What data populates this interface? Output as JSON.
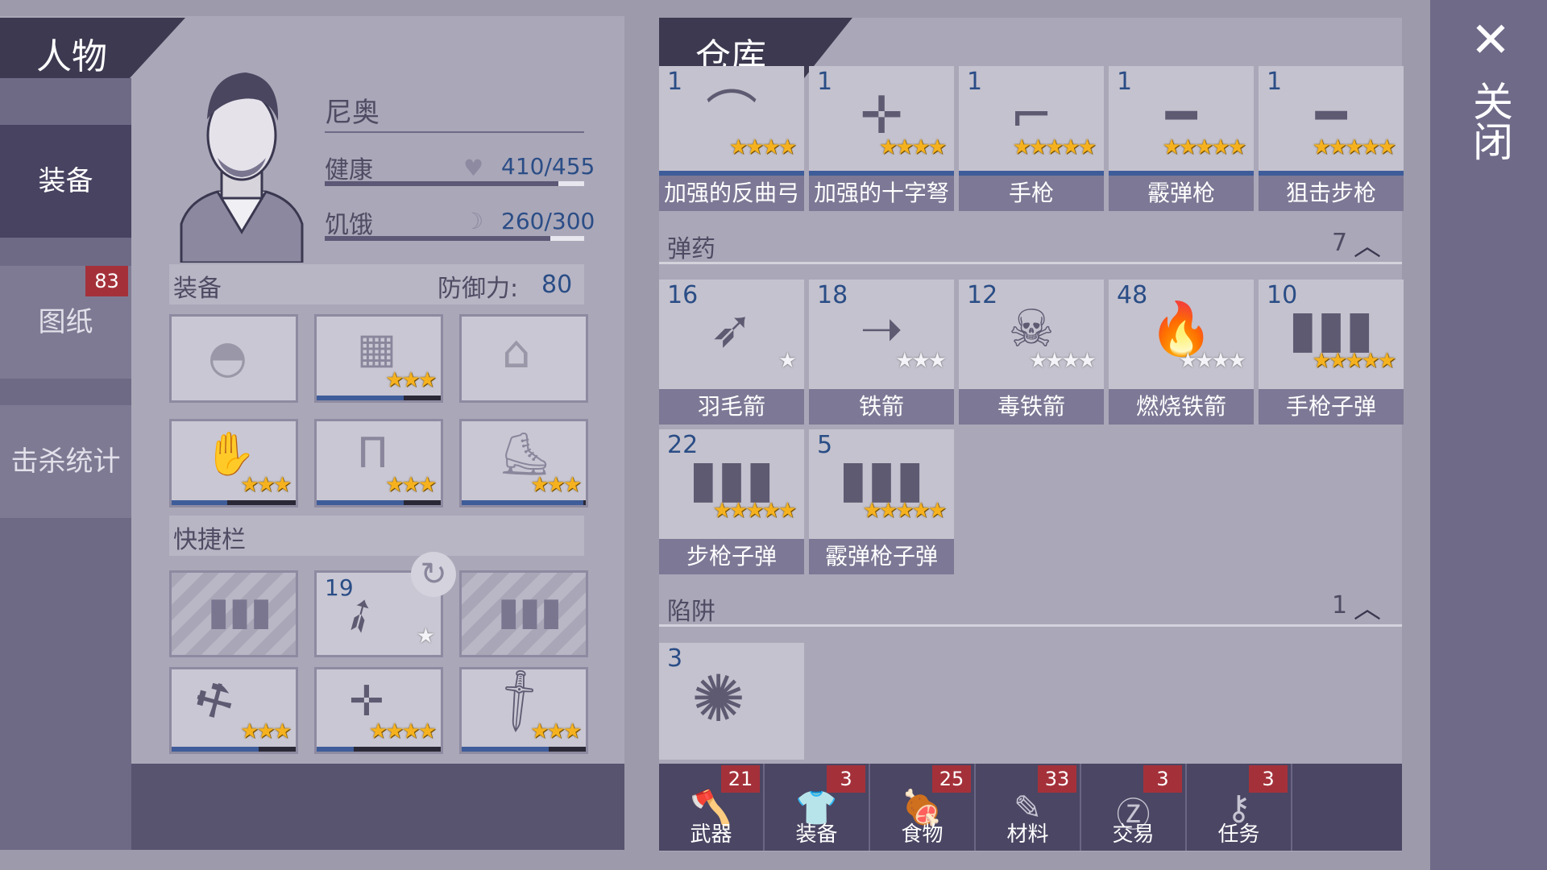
{
  "character": {
    "tab_title": "人物",
    "name": "尼奥",
    "health_label": "健康",
    "health_value": "410/455",
    "health_fraction": 0.9,
    "hunger_label": "饥饿",
    "hunger_value": "260/300",
    "hunger_fraction": 0.87,
    "side_tabs": [
      "装备",
      "图纸",
      "击杀统计"
    ],
    "blueprint_badge": "83",
    "equipment_label": "装备",
    "defense_label": "防御力:",
    "defense_value": "80",
    "equipment": [
      {
        "icon": "helmet-icon",
        "stars": 0
      },
      {
        "icon": "armor-vest-icon",
        "stars": 3
      },
      {
        "icon": "jacket-icon",
        "stars": 0
      },
      {
        "icon": "gloves-icon",
        "stars": 3
      },
      {
        "icon": "pants-icon",
        "stars": 3
      },
      {
        "icon": "boots-icon",
        "stars": 3
      }
    ],
    "quickbar_label": "快捷栏",
    "quickbar": [
      {
        "icon": "ammo-slot-icon",
        "empty": true
      },
      {
        "icon": "feather-arrow-icon",
        "qty": "19",
        "stars": 1,
        "empty_stars": true
      },
      {
        "icon": "ammo-slot-icon",
        "empty": true
      },
      {
        "icon": "spiked-club-icon",
        "stars": 3
      },
      {
        "icon": "crossbow-icon",
        "stars": 4
      },
      {
        "icon": "machete-icon",
        "stars": 3
      }
    ]
  },
  "warehouse": {
    "tab_title": "仓库",
    "weapons": [
      {
        "qty": "1",
        "name": "加强的反曲弓",
        "icon": "recurve-bow-icon",
        "stars": 4
      },
      {
        "qty": "1",
        "name": "加强的十字弩",
        "icon": "crossbow-icon",
        "stars": 4
      },
      {
        "qty": "1",
        "name": "手枪",
        "icon": "revolver-icon",
        "stars": 5
      },
      {
        "qty": "1",
        "name": "霰弹枪",
        "icon": "shotgun-icon",
        "stars": 5
      },
      {
        "qty": "1",
        "name": "狙击步枪",
        "icon": "sniper-rifle-icon",
        "stars": 5
      }
    ],
    "ammo_section": {
      "label": "弹药",
      "count": "7"
    },
    "ammo": [
      {
        "qty": "16",
        "name": "羽毛箭",
        "icon": "feather-arrow-icon",
        "stars": 1,
        "empty": true
      },
      {
        "qty": "18",
        "name": "铁箭",
        "icon": "iron-arrow-icon",
        "stars": 3,
        "empty": true
      },
      {
        "qty": "12",
        "name": "毒铁箭",
        "icon": "poison-arrow-icon",
        "stars": 4,
        "empty": true
      },
      {
        "qty": "48",
        "name": "燃烧铁箭",
        "icon": "fire-arrow-icon",
        "stars": 4,
        "empty": true
      },
      {
        "qty": "10",
        "name": "手枪子弹",
        "icon": "pistol-bullets-icon",
        "stars": 5
      },
      {
        "qty": "22",
        "name": "步枪子弹",
        "icon": "rifle-bullets-icon",
        "stars": 5
      },
      {
        "qty": "5",
        "name": "霰弹枪子弹",
        "icon": "shotgun-shells-icon",
        "stars": 5
      }
    ],
    "trap_section": {
      "label": "陷阱",
      "count": "1"
    },
    "traps": [
      {
        "qty": "3",
        "icon": "spider-web-trap-icon"
      }
    ]
  },
  "bottom_tabs": [
    {
      "label": "武器",
      "badge": "21",
      "icon": "axe-icon"
    },
    {
      "label": "装备",
      "badge": "3",
      "icon": "shirt-icon"
    },
    {
      "label": "食物",
      "badge": "25",
      "icon": "meat-icon"
    },
    {
      "label": "材料",
      "badge": "33",
      "icon": "wood-icon"
    },
    {
      "label": "交易",
      "badge": "3",
      "icon": "coin-icon"
    },
    {
      "label": "任务",
      "badge": "3",
      "icon": "key-icon"
    }
  ],
  "close_label": "关闭",
  "colors": {
    "accent": "#3d3950",
    "badge": "#a4313a",
    "star": "#f6b21e",
    "qty": "#2a4d86"
  }
}
